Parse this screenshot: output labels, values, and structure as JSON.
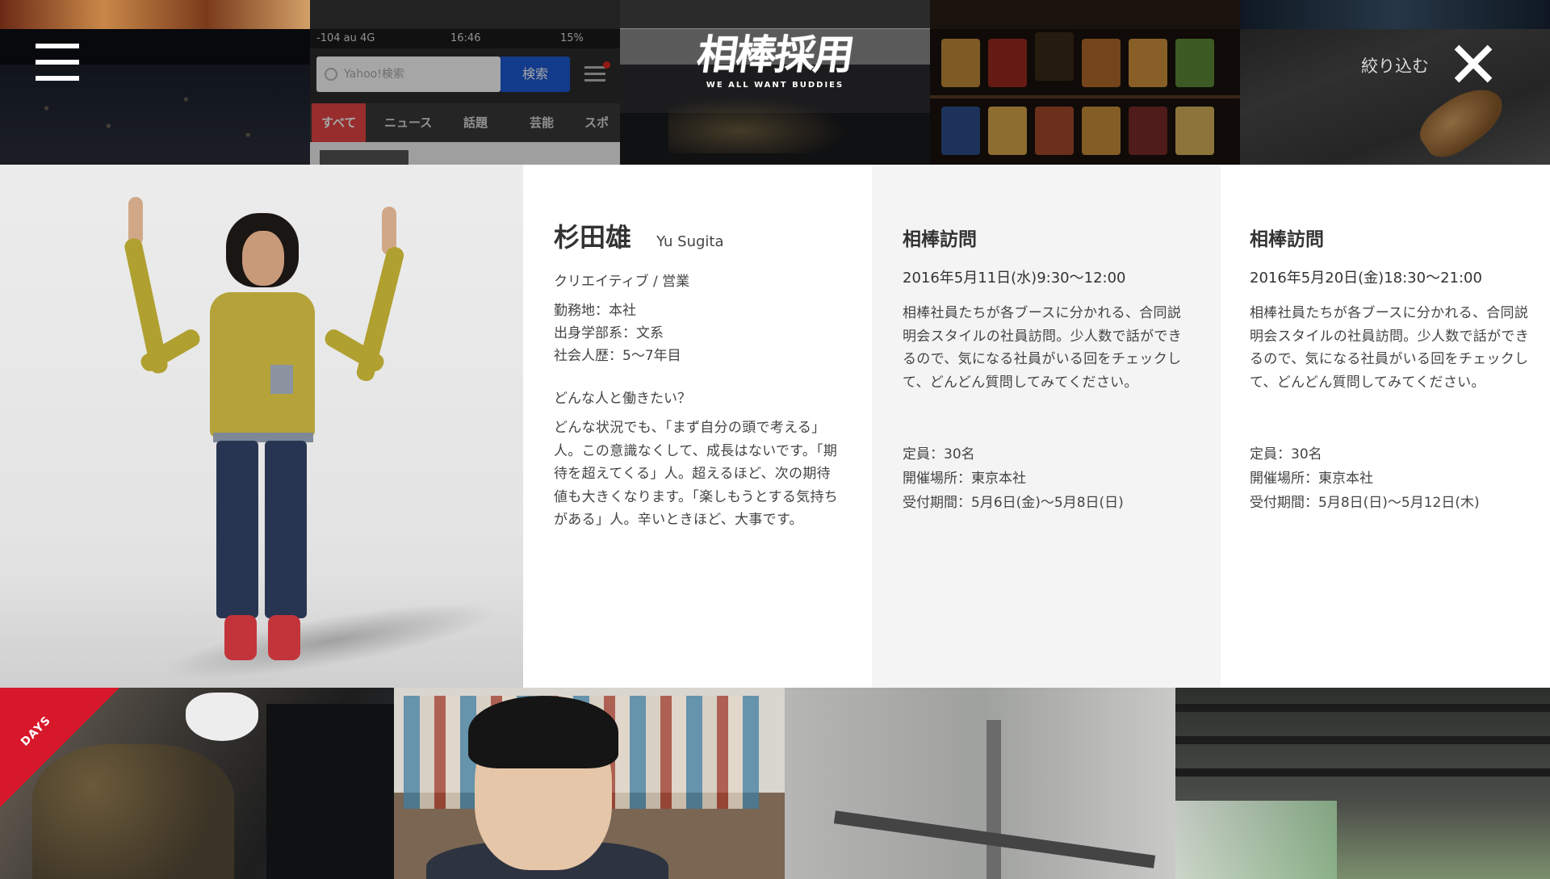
{
  "header": {
    "logo": {
      "mark": "相棒採用",
      "tagline": "WE ALL WANT BUDDIES"
    },
    "filter_label": "絞り込む",
    "menu_icon": "hamburger-icon",
    "close_icon": "close-icon"
  },
  "top_tiles": {
    "phone": {
      "carrier": "-104 au 4G",
      "time": "16:46",
      "battery": "15%",
      "search_placeholder": "Yahoo!検索",
      "search_button": "検索",
      "tabs": [
        "すべて",
        "ニュース",
        "話題",
        "芸能",
        "スポー"
      ]
    }
  },
  "profile": {
    "name_jp": "杉田雄",
    "name_en": "Yu Sugita",
    "role": "クリエイティブ / 営業",
    "facts": [
      "勤務地：本社",
      "出身学部系：文系",
      "社会人歴：5〜7年目"
    ],
    "question": "どんな人と働きたい？",
    "answer": "どんな状況でも、「まず自分の頭で考える」人。この意識なくして、成長はないです。「期待を超えてくる」人。超えるほど、次の期待値も大きくなります。「楽しもうとする気持ちがある」人。辛いときほど、大事です。"
  },
  "visits": [
    {
      "title": "相棒訪問",
      "date": "2016年5月11日(水)9:30〜12:00",
      "description": "相棒社員たちが各ブースに分かれる、合同説明会スタイルの社員訪問。少人数で話ができるので、気になる社員がいる回をチェックして、どんどん質問してみてください。",
      "capacity": "定員：30名",
      "venue": "開催場所：東京本社",
      "period": "受付期間：5月6日(金)〜5月8日(日)"
    },
    {
      "title": "相棒訪問",
      "date": "2016年5月20日(金)18:30〜21:00",
      "description": "相棒社員たちが各ブースに分かれる、合同説明会スタイルの社員訪問。少人数で話ができるので、気になる社員がいる回をチェックして、どんどん質問してみてください。",
      "capacity": "定員：30名",
      "venue": "開催場所：東京本社",
      "period": "受付期間：5月8日(日)〜5月12日(木)"
    }
  ],
  "bottom_tiles": {
    "ribbon_label": "DAYS"
  },
  "colors": {
    "accent_red": "#d7182a",
    "search_blue": "#1e5bd6",
    "panel_grey": "#f4f4f4"
  }
}
